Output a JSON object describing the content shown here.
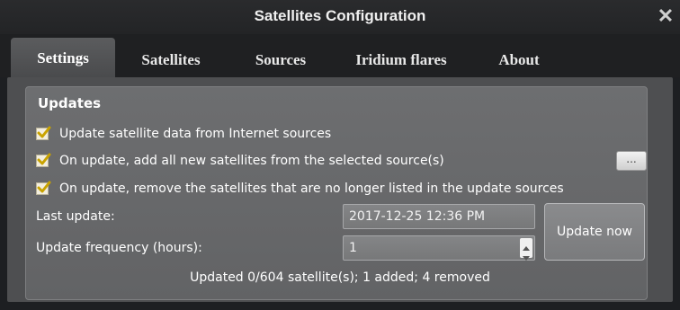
{
  "window": {
    "title": "Satellites Configuration",
    "close_glyph": "✕"
  },
  "tabs": [
    {
      "label": "Settings",
      "active": true
    },
    {
      "label": "Satellites",
      "active": false
    },
    {
      "label": "Sources",
      "active": false
    },
    {
      "label": "Iridium flares",
      "active": false
    },
    {
      "label": "About",
      "active": false
    }
  ],
  "updates": {
    "section_title": "Updates",
    "checkboxes": [
      {
        "label": "Update satellite data from Internet sources",
        "checked": true
      },
      {
        "label": "On update, add all new satellites from the selected source(s)",
        "checked": true
      },
      {
        "label": "On update, remove the satellites that are no longer listed in the update sources",
        "checked": true
      }
    ],
    "sources_button": "...",
    "last_update_label": "Last update:",
    "last_update_value": "2017-12-25 12:36 PM",
    "frequency_label": "Update frequency (hours):",
    "frequency_value": "1",
    "update_now_button": "Update now",
    "status_text": "Updated 0/604 satellite(s); 1 added; 4 removed"
  },
  "colors": {
    "checkmark": "#c9a300",
    "accent_panel": "#626365"
  }
}
